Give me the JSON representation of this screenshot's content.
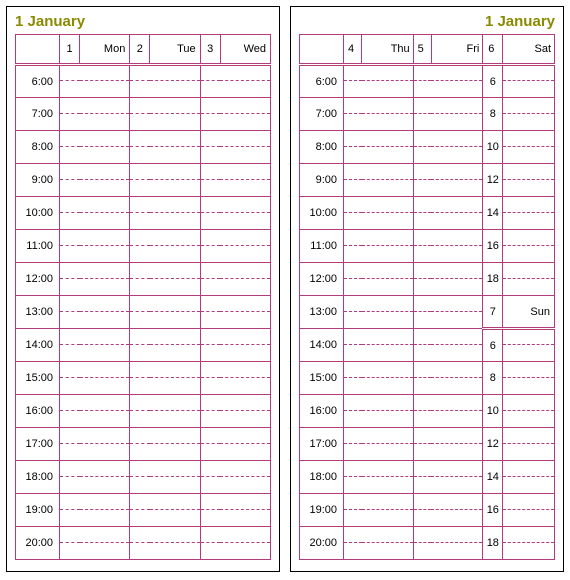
{
  "left": {
    "title": "1 January",
    "days": [
      {
        "num": "1",
        "dow": "Mon"
      },
      {
        "num": "2",
        "dow": "Tue"
      },
      {
        "num": "3",
        "dow": "Wed"
      }
    ],
    "times": [
      "6:00",
      "7:00",
      "8:00",
      "9:00",
      "10:00",
      "11:00",
      "12:00",
      "13:00",
      "14:00",
      "15:00",
      "16:00",
      "17:00",
      "18:00",
      "19:00",
      "20:00"
    ]
  },
  "right": {
    "title": "1 January",
    "days_top": [
      {
        "num": "4",
        "dow": "Thu"
      },
      {
        "num": "5",
        "dow": "Fri"
      },
      {
        "num": "6",
        "dow": "Sat"
      }
    ],
    "times": [
      "6:00",
      "7:00",
      "8:00",
      "9:00",
      "10:00",
      "11:00",
      "12:00",
      "13:00",
      "14:00",
      "15:00",
      "16:00",
      "17:00",
      "18:00",
      "19:00",
      "20:00"
    ],
    "sat_hours": [
      "6",
      "8",
      "10",
      "12",
      "14",
      "16",
      "18"
    ],
    "sun_header": {
      "num": "7",
      "dow": "Sun"
    },
    "sun_hours": [
      "6",
      "8",
      "10",
      "12",
      "14",
      "16",
      "18"
    ]
  }
}
